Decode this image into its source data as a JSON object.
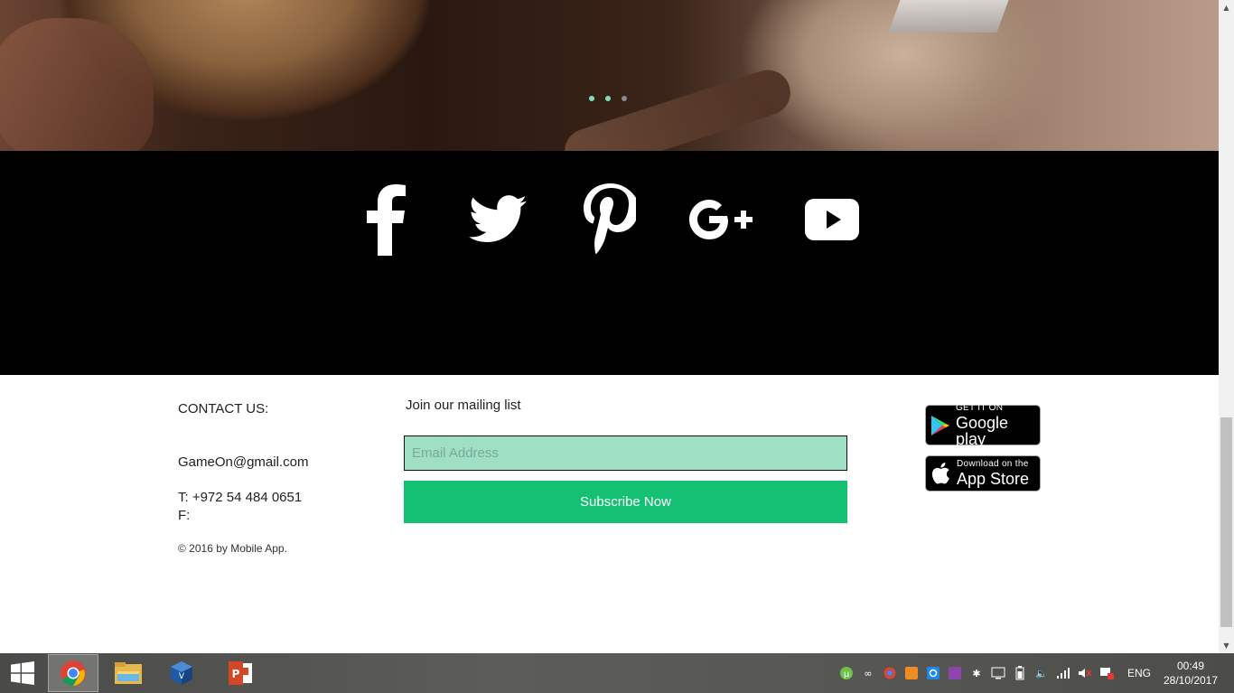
{
  "slider": {
    "dots": [
      {
        "color": "#7fe0c0"
      },
      {
        "color": "#7fe0c0"
      },
      {
        "color": "#8a8a8a"
      }
    ]
  },
  "social": [
    "facebook-icon",
    "twitter-icon",
    "pinterest-icon",
    "google-plus-icon",
    "youtube-icon"
  ],
  "contact": {
    "title": "CONTACT US:",
    "email": "GameOn@gmail.com",
    "phone": "T: +972 54 484 0651",
    "fax": "F:",
    "copyright": "© 2016 by Mobile App."
  },
  "mailing": {
    "title": "Join our mailing list",
    "placeholder": "Email Address",
    "button": "Subscribe Now"
  },
  "stores": {
    "google_small": "GET IT ON",
    "google_big": "Google play",
    "apple_small": "Download on the",
    "apple_big": "App Store"
  },
  "taskbar": {
    "apps": [
      "chrome-icon",
      "file-explorer-icon",
      "virtualbox-icon",
      "powerpoint-icon"
    ],
    "lang": "ENG",
    "time": "00:49",
    "date": "28/10/2017"
  },
  "colors": {
    "accent": "#14c174",
    "input_bg": "#9fdfc4"
  }
}
